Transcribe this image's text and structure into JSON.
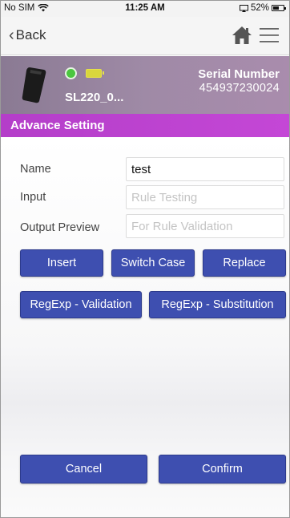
{
  "status_bar": {
    "carrier": "No SIM",
    "time": "11:25 AM",
    "battery": "52%"
  },
  "nav": {
    "back_label": "Back",
    "icons": [
      "home-icon",
      "menu-icon"
    ]
  },
  "device": {
    "name": "SL220_0...",
    "connection_status_color": "#4bc640",
    "battery_color": "#d9d63c",
    "serial_label": "Serial Number",
    "serial_value": "454937230024"
  },
  "section": {
    "title": "Advance Setting"
  },
  "form": {
    "name_label": "Name",
    "name_value": "test",
    "input_label": "Input",
    "input_placeholder": "Rule Testing",
    "output_label": "Output Preview",
    "output_placeholder": "For Rule Validation"
  },
  "buttons": {
    "insert": "Insert",
    "switch_case": "Switch Case",
    "replace": "Replace",
    "regexp_validation": "RegExp - Validation",
    "regexp_substitution": "RegExp - Substitution",
    "cancel": "Cancel",
    "confirm": "Confirm"
  },
  "colors": {
    "accent_button": "#3e4fb0",
    "section_header": "#b43ec9"
  }
}
